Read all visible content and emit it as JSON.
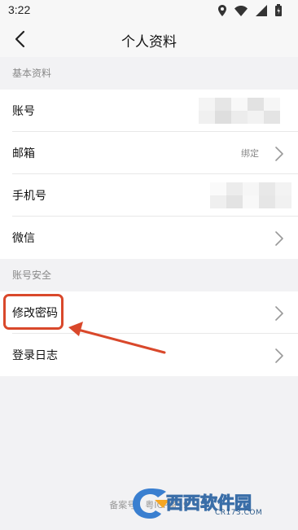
{
  "status_bar": {
    "time": "3:22"
  },
  "nav": {
    "title": "个人资料"
  },
  "sections": {
    "basic": {
      "header": "基本资料",
      "rows": [
        {
          "label": "账号"
        },
        {
          "label": "邮箱",
          "value": "绑定"
        },
        {
          "label": "手机号"
        },
        {
          "label": "微信"
        }
      ]
    },
    "security": {
      "header": "账号安全",
      "rows": [
        {
          "label": "修改密码"
        },
        {
          "label": "登录日志"
        }
      ]
    }
  },
  "footer": {
    "text": "备案号：粤ICP备19"
  },
  "watermark": {
    "brand": "西西软件园",
    "domain": "CR173.COM"
  },
  "colors": {
    "annotation": "#d9482b",
    "background": "#f2f2f4"
  }
}
